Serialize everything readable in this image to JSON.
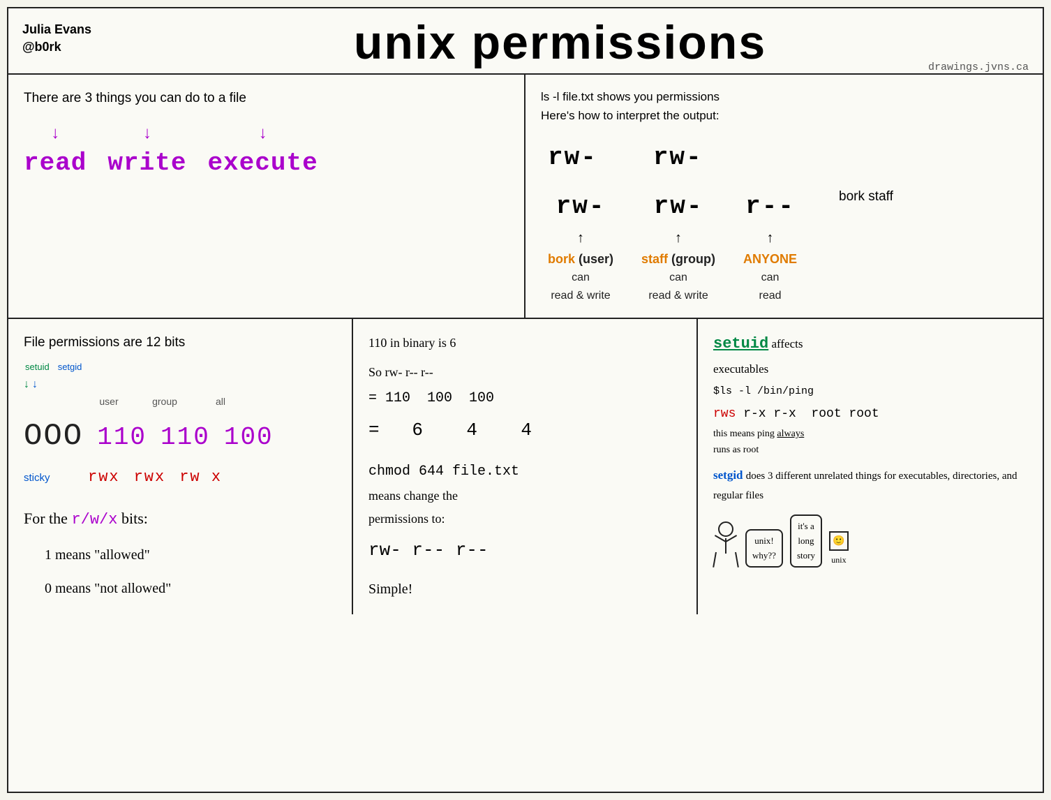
{
  "header": {
    "author": "Julia Evans",
    "handle": "@b0rk",
    "title": "unix permissions",
    "site": "drawings.jvns.ca"
  },
  "top_left": {
    "intro": "There are 3 things you can do to a file",
    "items": [
      {
        "arrow": "↓",
        "word": "read"
      },
      {
        "arrow": "↓",
        "word": "write"
      },
      {
        "arrow": "↓",
        "word": "execute"
      }
    ]
  },
  "top_right": {
    "line1": "ls -l file.txt shows you permissions",
    "line2": "Here's how to interpret the output:",
    "columns": [
      {
        "perms": "rw-",
        "arrow": "↑",
        "label_top": "bork (user)",
        "label_mid": "can",
        "label_bot": "read & write",
        "color": "orange"
      },
      {
        "perms": "rw-",
        "arrow": "↑",
        "label_top": "staff (group)",
        "label_mid": "can",
        "label_bot": "read & write",
        "color": "orange"
      },
      {
        "perms": "r--",
        "arrow": "↑",
        "label_top": "ANYONE",
        "label_mid": "can",
        "label_bot": "read",
        "color": "orange"
      }
    ],
    "bork_staff": "bork staff"
  },
  "bottom_left": {
    "title": "File permissions are 12 bits",
    "setuid_label": "setuid",
    "setgid_label": "setgid",
    "sticky_label": "sticky",
    "ooo": "OOO",
    "bits_user": "110",
    "bits_group": "110",
    "bits_all": "100",
    "labels": [
      "user",
      "group",
      "all"
    ],
    "rwx_user": "rwx",
    "rwx_group": "rwx",
    "rwx_all": "rw x",
    "for_bits": "For the r/w/x bits:",
    "rule1": "1 means \"allowed\"",
    "rule0": "0 means \"not allowed\""
  },
  "bottom_mid": {
    "line1": "110 in binary is 6",
    "eq1": "So rw-  r--   r--",
    "eq2": "   = 110  100  100",
    "eq3": "   =  6    4    4",
    "chmod_intro": "chmod  644 file.txt",
    "chmod_desc1": "means change the",
    "chmod_desc2": "permissions to:",
    "chmod_result": "rw-  r--  r--",
    "simple": "Simple!"
  },
  "bottom_right": {
    "setuid_word": "setuid",
    "affects": "affects",
    "executables": "executables",
    "ls_cmd": "$ls -l /bin/ping",
    "rws_line": "rws r-x r-x  root root",
    "rws_note": "this means ping always runs as root",
    "setgid_word": "setgid",
    "setgid_desc": "does 3 different unrelated things for executables, directories, and regular files",
    "bubble1_line1": "unix!",
    "bubble1_line2": "why??",
    "bubble2_line1": "it's a",
    "bubble2_line2": "long",
    "bubble2_line3": "story",
    "unix_label": "unix"
  }
}
